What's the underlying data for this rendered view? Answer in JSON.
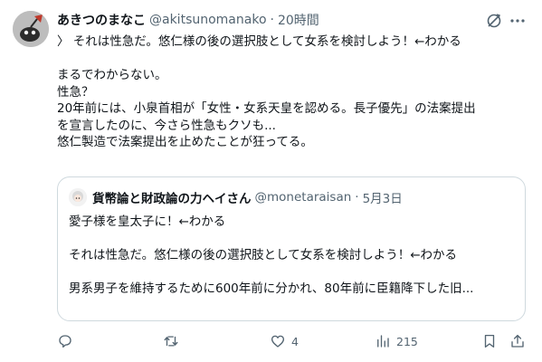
{
  "tweet": {
    "author_name": "あきつのまなこ",
    "author_handle": "@akitsunomanako",
    "separator": "·",
    "time": "20時間",
    "lines": [
      "〉 それは性急だ。悠仁様の後の選択肢として女系を検討しよう！←わかる",
      "",
      "まるでわからない。",
      "性急？",
      "20年前には、小泉首相が「女性・女系天皇を認める。長子優先」の法案提出",
      "を宣言したのに、今さら性急もクソも...",
      "悠仁製造で法案提出を止めたことが狂ってる。"
    ]
  },
  "quote": {
    "author_name": "貨幣論と財政論の力ヘイさん",
    "author_handle": "@monetaraisan",
    "separator": "·",
    "date": "5月3日",
    "lines": [
      "愛子様を皇太子に！←わかる",
      "",
      "それは性急だ。悠仁様の後の選択肢として女系を検討しよう！←わかる",
      "",
      "男系男子を維持するために600年前に分かれ、80年前に臣籍降下した旧..."
    ]
  },
  "actions": {
    "reply_count": "",
    "repost_count": "",
    "like_count": "4",
    "views_count": "215"
  },
  "icons": {
    "reply": "reply-icon",
    "repost": "repost-icon",
    "like": "like-icon",
    "views": "views-icon",
    "bookmark": "bookmark-icon",
    "share": "share-icon",
    "grok": "grok-icon",
    "more": "more-icon"
  },
  "colors": {
    "text": "#0f1419",
    "secondary": "#536471",
    "border": "#cfd9de"
  }
}
